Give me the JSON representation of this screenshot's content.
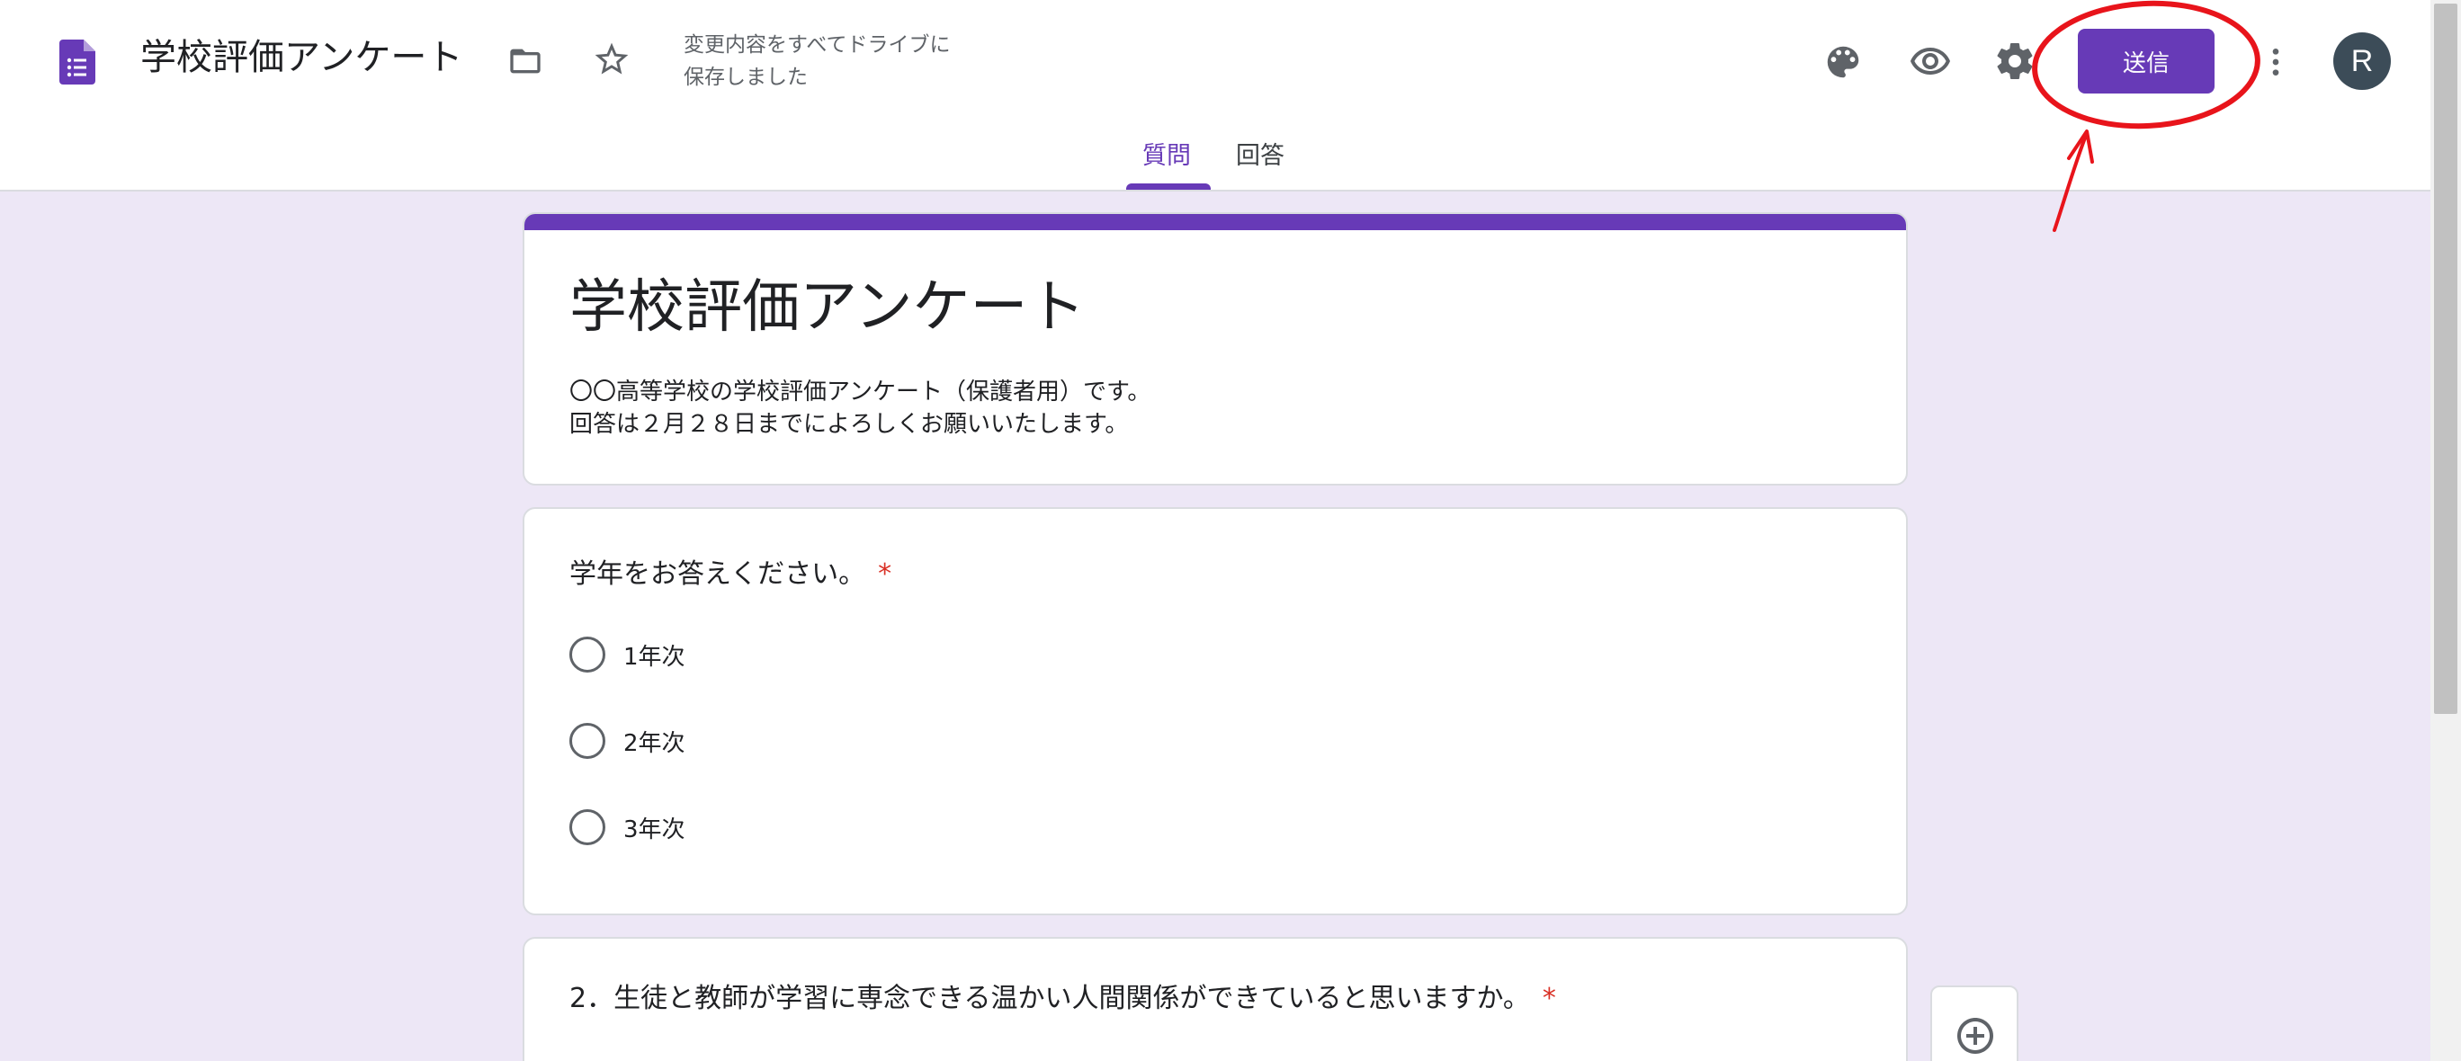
{
  "header": {
    "doc_title": "学校評価アンケート",
    "save_status": "変更内容をすべてドライブに\n保存しました",
    "send_label": "送信",
    "avatar_letter": "R",
    "icons": [
      "forms-logo-icon",
      "folder-icon",
      "star-icon",
      "palette-icon",
      "preview-eye-icon",
      "settings-gear-icon",
      "more-vert-icon"
    ]
  },
  "tabs": [
    {
      "label": "質問",
      "active": true
    },
    {
      "label": "回答",
      "active": false
    }
  ],
  "form": {
    "title": "学校評価アンケート",
    "description": "〇〇高等学校の学校評価アンケート（保護者用）です。\n回答は２月２８日までによろしくお願いいたします。"
  },
  "questions": [
    {
      "text": "学年をお答えください。",
      "required_mark": "*",
      "options": [
        "1年次",
        "2年次",
        "3年次"
      ]
    },
    {
      "text": "2．生徒と教師が学習に専念できる温かい人間関係ができていると思いますか。",
      "required_mark": "*"
    }
  ],
  "colors": {
    "accent": "#673ab7",
    "background": "#ede7f6",
    "required": "#d93025",
    "annotation": "#e8141b"
  }
}
